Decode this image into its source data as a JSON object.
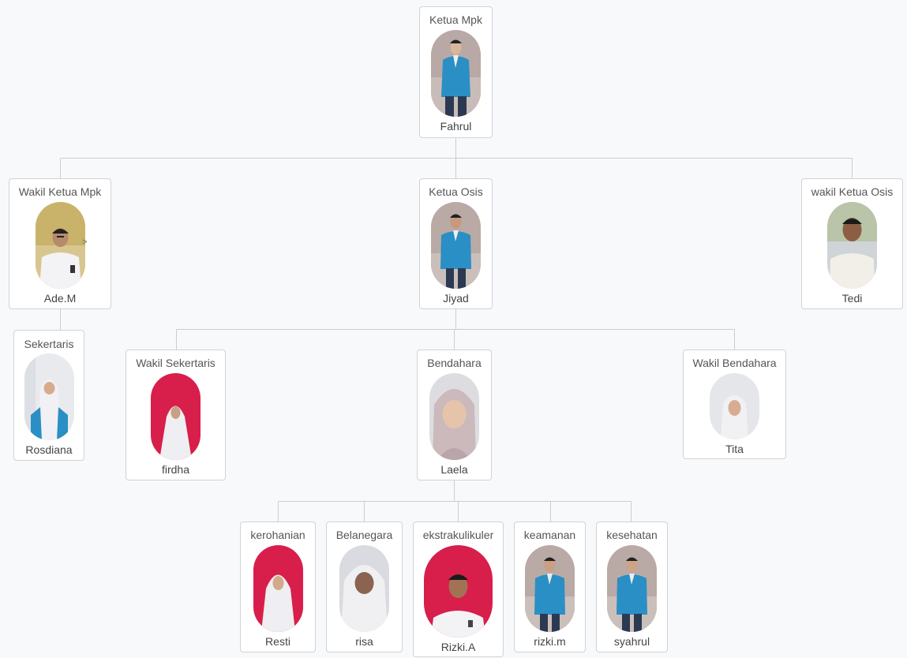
{
  "nodes": {
    "ketua_mpk": {
      "role": "Ketua Mpk",
      "name": "Fahrul"
    },
    "wakil_ketua_mpk": {
      "role": "Wakil Ketua Mpk",
      "name": "Ade.M"
    },
    "ketua_osis": {
      "role": "Ketua Osis",
      "name": "Jiyad"
    },
    "wakil_ketua_osis": {
      "role": "wakil Ketua Osis",
      "name": "Tedi"
    },
    "sekertaris": {
      "role": "Sekertaris",
      "name": "Rosdiana"
    },
    "wakil_sekertaris": {
      "role": "Wakil Sekertaris",
      "name": "firdha"
    },
    "bendahara": {
      "role": "Bendahara",
      "name": "Laela"
    },
    "wakil_bendahara": {
      "role": "Wakil Bendahara",
      "name": "Tita"
    },
    "kerohanian": {
      "role": "kerohanian",
      "name": "Resti"
    },
    "belanegara": {
      "role": "Belanegara",
      "name": "risa"
    },
    "ekstrakulikuler": {
      "role": "ekstrakulikuler",
      "name": "Rizki.A"
    },
    "keamanan": {
      "role": "keamanan",
      "name": "rizki.m"
    },
    "kesehatan": {
      "role": "kesehatan",
      "name": "syahrul"
    }
  },
  "expand_marker": ">",
  "colors": {
    "connector": "#c9cdd2",
    "card_border": "#cfd3d8",
    "background": "#f8f9fb",
    "uniform_blue": "#2a8fc4",
    "red_backdrop": "#d81e4a",
    "hijab_white": "#ecebf0"
  }
}
